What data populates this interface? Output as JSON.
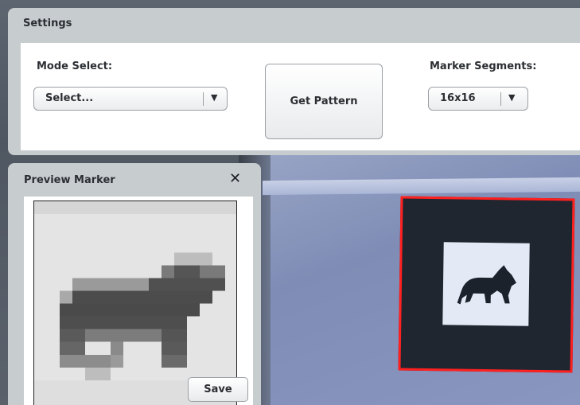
{
  "settings": {
    "title": "Settings",
    "mode_label": "Mode Select:",
    "mode_value": "Select...",
    "get_pattern_label": "Get Pattern",
    "segments_label": "Marker Segments:",
    "segments_value": "16x16"
  },
  "preview": {
    "title": "Preview Marker",
    "close_glyph": "✕",
    "save_label": "Save"
  },
  "icons": {
    "dropdown": "chevron-down-icon",
    "close": "close-icon"
  },
  "colors": {
    "marker_border": "#ff2020",
    "panel": "#c7cccf"
  }
}
